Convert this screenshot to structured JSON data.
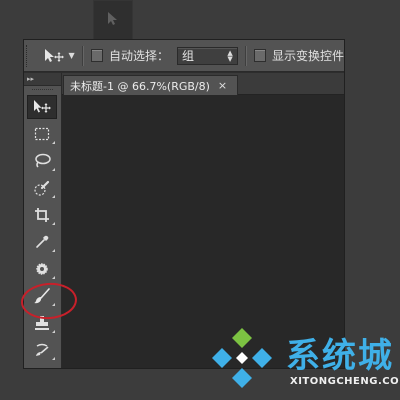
{
  "options_bar": {
    "tool_preset_icon": "move-icon",
    "auto_select_label": "自动选择：",
    "auto_select_checked": false,
    "auto_select_mode": "组",
    "show_transform_label": "显示变换控件",
    "show_transform_checked": false
  },
  "toolbar": {
    "header_glyph": "▸▸",
    "tools": [
      {
        "icon": "move-icon",
        "active": true
      },
      {
        "icon": "marquee-icon",
        "active": false
      },
      {
        "icon": "lasso-icon",
        "active": false
      },
      {
        "icon": "quick-selection-icon",
        "active": false
      },
      {
        "icon": "crop-icon",
        "active": false
      },
      {
        "icon": "eyedropper-icon",
        "active": false
      },
      {
        "icon": "spot-healing-icon",
        "active": false
      },
      {
        "icon": "brush-icon",
        "active": false,
        "highlighted": true
      },
      {
        "icon": "clone-stamp-icon",
        "active": false
      },
      {
        "icon": "history-brush-icon",
        "active": false
      }
    ]
  },
  "document_tab": {
    "title": "未标题-1 @ 66.7%(RGB/8)",
    "close_glyph": "×"
  },
  "watermark": {
    "title": "系统城",
    "url": "XITONGCHENG.COM",
    "colors": {
      "blue": "#3fb0e8",
      "green": "#7cc242"
    }
  },
  "colors": {
    "panel": "#535353",
    "canvas": "#282828",
    "highlight_circle": "#c8202a"
  }
}
